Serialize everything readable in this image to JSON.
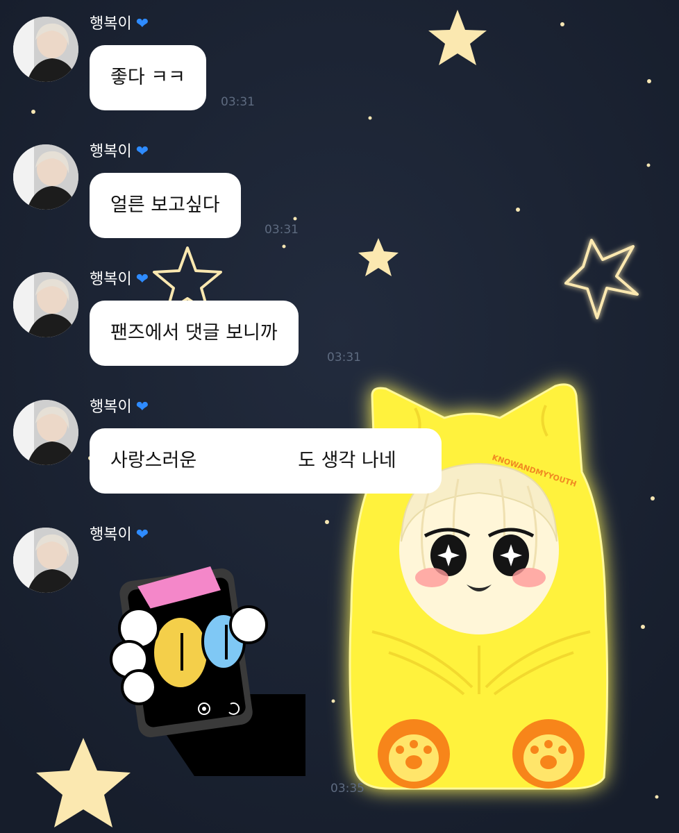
{
  "chat": {
    "messages": [
      {
        "sender": "행복이",
        "text": "좋다 ㅋㅋ",
        "time": "03:31"
      },
      {
        "sender": "행복이",
        "text": "얼른 보고싶다",
        "time": "03:31"
      },
      {
        "sender": "행복이",
        "text": "팬즈에서 댓글 보니까",
        "time": "03:31"
      },
      {
        "sender": "행복이",
        "text_before": "사랑스러운",
        "text_after": "도 생각 나네"
      },
      {
        "sender": "행복이",
        "sticker": "cat-phone-sticker",
        "time": "03:35"
      }
    ]
  },
  "background": {
    "theme": "night-sky",
    "character_caption": "KNOWANDMYYOUTH",
    "colors": {
      "sky": "#1d2536",
      "star": "#fbe8b0",
      "glow": "#fff27a",
      "costume": "#fff23e",
      "paw": "#f7851a",
      "heart": "#2e8bff",
      "time": "#5e6b80"
    }
  }
}
